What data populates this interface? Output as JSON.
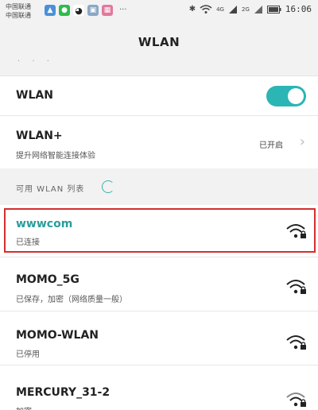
{
  "status_bar": {
    "carrier_1": "中国联通",
    "carrier_2": "中国联通",
    "notification_icons": [
      "photos-icon",
      "wechat-icon",
      "qq-icon",
      "gallery-icon",
      "app-icon"
    ],
    "more": "···",
    "network_1": "4G",
    "network_2": "2G",
    "time": "16:06"
  },
  "header": {
    "title": "WLAN"
  },
  "wlan_toggle": {
    "label": "WLAN",
    "state": "on",
    "color": "#2bb5b5"
  },
  "wlan_plus": {
    "label": "WLAN+",
    "subtitle": "提升网络智能连接体验",
    "status": "已开启"
  },
  "available_section": {
    "label": "可用 WLAN 列表"
  },
  "networks": [
    {
      "name": "wwwcom",
      "status": "已连接",
      "connected": true,
      "secure": true,
      "name_color": "#2a9d9d"
    },
    {
      "name": "MOMO_5G",
      "status": "已保存，加密（网络质量一般）",
      "connected": false,
      "secure": true
    },
    {
      "name": "MOMO-WLAN",
      "status": "已停用",
      "connected": false,
      "secure": true
    },
    {
      "name": "MERCURY_31-2",
      "status": "加密",
      "connected": false,
      "secure": true
    }
  ],
  "highlight_color": "#d32f2f"
}
